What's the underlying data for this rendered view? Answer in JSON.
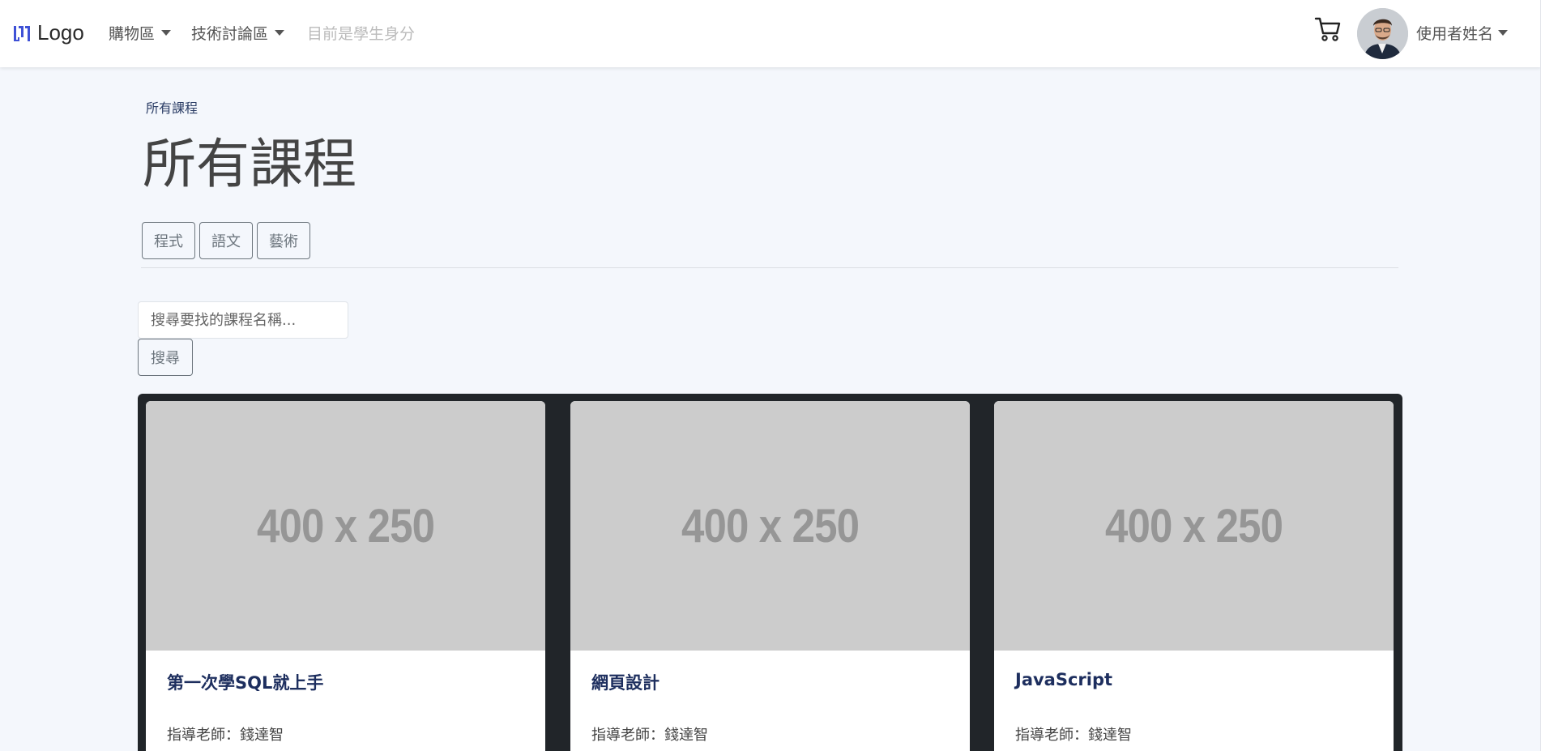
{
  "navbar": {
    "brand_text": "Logo",
    "shop_label": "購物區",
    "tech_label": "技術討論區",
    "role_label": "目前是學生身分",
    "user_name": "使用者姓名"
  },
  "breadcrumb": "所有課程",
  "page_title": "所有課程",
  "categories": [
    "程式",
    "語文",
    "藝術"
  ],
  "search": {
    "placeholder": "搜尋要找的課程名稱...",
    "value": "",
    "button_label": "搜尋"
  },
  "courses": [
    {
      "image_label": "400 x 250",
      "title": "第一次學SQL就上手",
      "teacher": "指導老師：錢達智"
    },
    {
      "image_label": "400 x 250",
      "title": "網頁設計",
      "teacher": "指導老師：錢達智"
    },
    {
      "image_label": "400 x 250",
      "title": "JavaScript",
      "teacher": "指導老師：錢達智"
    }
  ],
  "colors": {
    "page_bg": "#f4f7fc",
    "brand_icon": "#3f51d6",
    "card_title": "#1d2e5e",
    "grid_bg": "#212529",
    "placeholder_bg": "#cccccc"
  },
  "icons": [
    "logo-icon",
    "cart-icon",
    "caret-down-icon",
    "avatar"
  ]
}
